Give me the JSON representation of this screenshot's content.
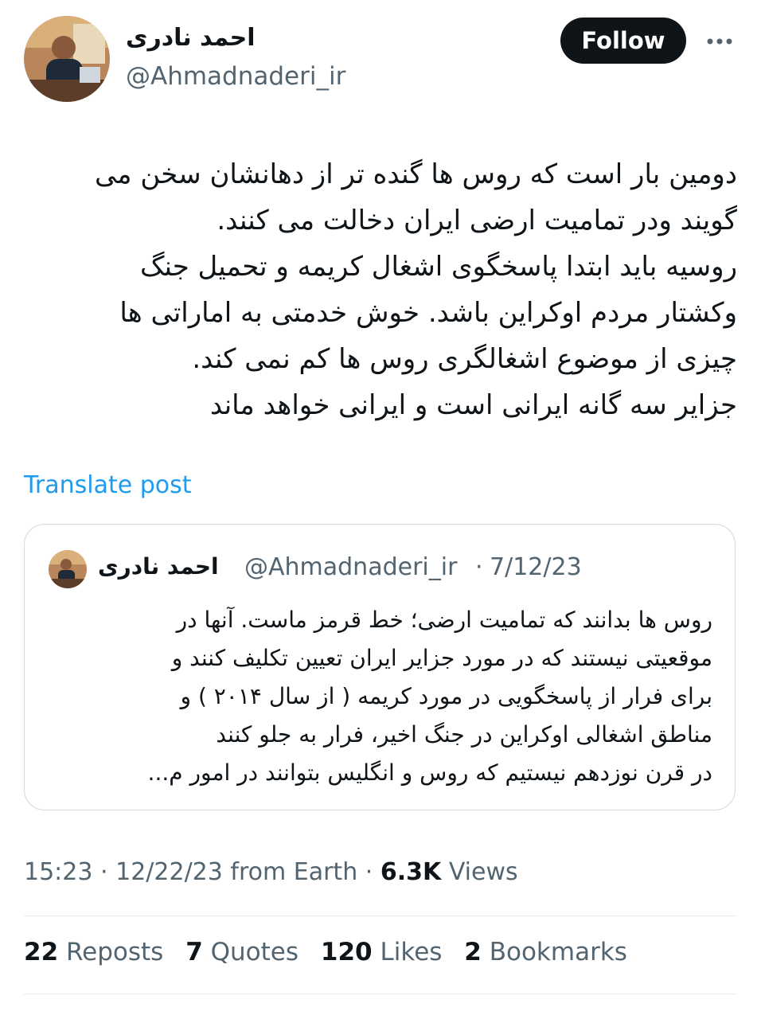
{
  "author": {
    "display_name": "احمد نادری",
    "handle": "@Ahmadnaderi_ir"
  },
  "follow_label": "Follow",
  "more_icon": "more-horizontal-icon",
  "tweet": {
    "lines": [
      "دومین بار است که روس ها گنده تر از دهانشان سخن می",
      "گویند ودر تمامیت ارضی ایران دخالت می کنند.",
      "روسیه باید ابتدا پاسخگوی اشغال کریمه و تحمیل جنگ",
      "وکشتار مردم اوکراین باشد. خوش خدمتی به اماراتی ها",
      "چیزی از موضوع اشغالگری روس ها کم نمی کند.",
      "جزایر سه گانه ایرانی است و ایرانی خواهد ماند"
    ],
    "translate_label": "Translate post"
  },
  "quote": {
    "display_name": "احمد نادری",
    "handle": "@Ahmadnaderi_ir",
    "separator": "·",
    "date": "7/12/23",
    "lines": [
      "روس ها بدانند که تمامیت ارضی؛ خط قرمز ماست. آنها در",
      "موقعیتی نیستند که در مورد جزایر ایران تعیین تکلیف کنند و",
      "برای فرار از پاسخگویی در مورد کریمه ( از سال ۲۰۱۴ ) و",
      "مناطق اشغالی اوکراین در جنگ اخیر، فرار به جلو کنند",
      "در قرن نوزدهم نیستیم که روس و انگلیس بتوانند در امور م..."
    ]
  },
  "meta": {
    "time": "15:23",
    "date": "12/22/23",
    "source": "from Earth",
    "sep": "·",
    "views_count": "6.3K",
    "views_label": "Views"
  },
  "stats": [
    {
      "count": "22",
      "label": "Reposts"
    },
    {
      "count": "7",
      "label": "Quotes"
    },
    {
      "count": "120",
      "label": "Likes"
    },
    {
      "count": "2",
      "label": "Bookmarks"
    }
  ]
}
